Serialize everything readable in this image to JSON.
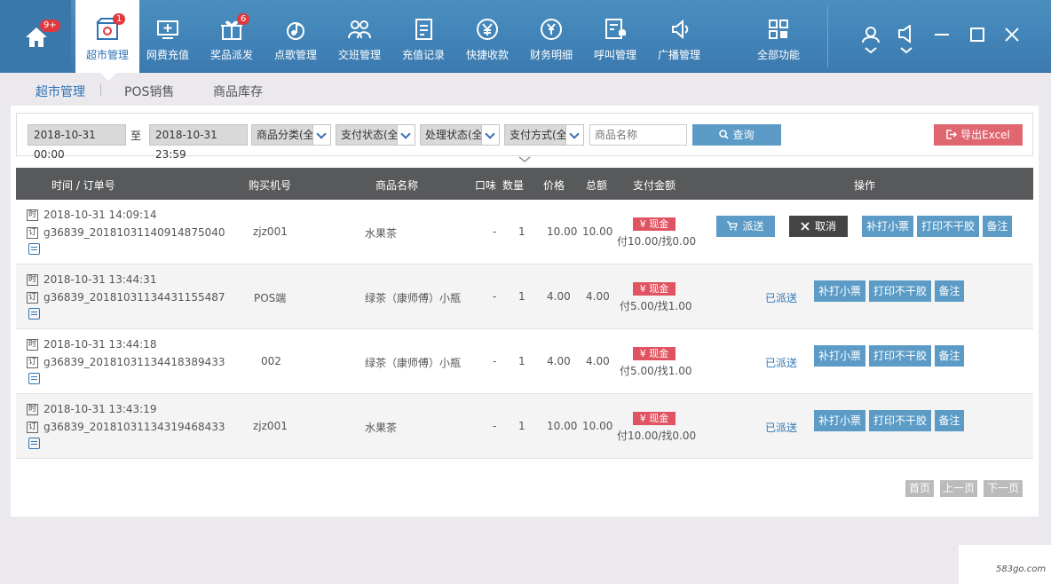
{
  "nav": {
    "home_badge": "9+",
    "items": [
      {
        "label": "超市管理",
        "badge": "1",
        "icon": "store-gear-icon"
      },
      {
        "label": "网费充值",
        "icon": "monitor-plus-icon"
      },
      {
        "label": "奖品派发",
        "badge": "6",
        "icon": "gift-icon"
      },
      {
        "label": "点歌管理",
        "icon": "music-icon"
      },
      {
        "label": "交班管理",
        "icon": "users-icon"
      },
      {
        "label": "充值记录",
        "icon": "receipt-icon"
      },
      {
        "label": "快捷收款",
        "icon": "yen-circle-icon"
      },
      {
        "label": "财务明细",
        "icon": "piggy-yen-icon"
      },
      {
        "label": "呼叫管理",
        "icon": "bell-doc-icon"
      },
      {
        "label": "广播管理",
        "icon": "broadcast-icon"
      },
      {
        "label": "全部功能",
        "icon": "grid-icon"
      }
    ]
  },
  "subtabs": [
    "超市管理",
    "POS销售",
    "商品库存"
  ],
  "filters": {
    "start": "2018-10-31 00:00",
    "to": "至",
    "end": "2018-10-31 23:59",
    "category": "商品分类(全",
    "pay_status": "支付状态(全",
    "process_status": "处理状态(全",
    "pay_method": "支付方式(全",
    "search_placeholder": "商品名称",
    "query": "查询",
    "export": "导出Excel"
  },
  "columns": [
    "时间 / 订单号",
    "购买机号",
    "商品名称",
    "口味",
    "数量",
    "价格",
    "总额",
    "支付金额",
    "操作"
  ],
  "rows": [
    {
      "time": "2018-10-31 14:09:14",
      "order": "g36839_20181031140914875040",
      "machine": "zjz001",
      "product": "水果茶",
      "flavor": "-",
      "qty": "1",
      "price": "10.00",
      "total": "10.00",
      "pay_tag": "¥ 现金",
      "pay_detail": "付10.00/找0.00",
      "status": "",
      "dispatch": "派送",
      "cancel": "取消"
    },
    {
      "time": "2018-10-31 13:44:31",
      "order": "g36839_20181031134431155487",
      "machine": "POS端",
      "product": "绿茶（康师傅）小瓶",
      "flavor": "-",
      "qty": "1",
      "price": "4.00",
      "total": "4.00",
      "pay_tag": "¥ 现金",
      "pay_detail": "付5.00/找1.00",
      "status": "已派送"
    },
    {
      "time": "2018-10-31 13:44:18",
      "order": "g36839_20181031134418389433",
      "machine": "002",
      "product": "绿茶（康师傅）小瓶",
      "flavor": "-",
      "qty": "1",
      "price": "4.00",
      "total": "4.00",
      "pay_tag": "¥ 现金",
      "pay_detail": "付5.00/找1.00",
      "status": "已派送"
    },
    {
      "time": "2018-10-31 13:43:19",
      "order": "g36839_20181031134319468433",
      "machine": "zjz001",
      "product": "水果茶",
      "flavor": "-",
      "qty": "1",
      "price": "10.00",
      "total": "10.00",
      "pay_tag": "¥ 现金",
      "pay_detail": "付10.00/找0.00",
      "status": "已派送"
    }
  ],
  "row_actions": {
    "reprint": "补打小票",
    "print_label": "打印不干胶",
    "note": "备注"
  },
  "time_glyph": "时",
  "order_glyph": "订",
  "pager": {
    "first": "首页",
    "prev": "上一页",
    "next": "下一页"
  },
  "watermark": "583go.com",
  "colors": {
    "topbar": "#4a8fc0",
    "active": "#2f74b5",
    "export": "#e06670",
    "cash": "#e05461"
  }
}
